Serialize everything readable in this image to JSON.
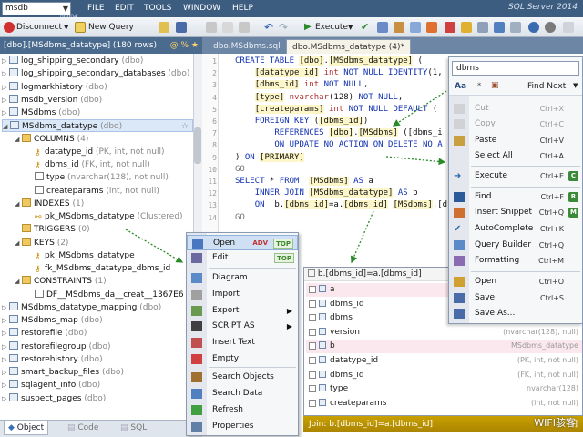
{
  "app": {
    "db_select": "msdb",
    "db_sub": "dbo04",
    "brand": "SQL Server 2014"
  },
  "menu": [
    "FILE",
    "EDIT",
    "TOOLS",
    "WINDOW",
    "HELP"
  ],
  "toolbar": {
    "disconnect": "Disconnect",
    "new_query": "New Query",
    "execute": "Execute"
  },
  "left_panel": {
    "title": "[dbo].[MSdbms_datatype] (180 rows)",
    "tabs": [
      "Object",
      "Code",
      "SQL"
    ]
  },
  "tree": [
    {
      "label": "log_shipping_secondary",
      "note": "(dbo)"
    },
    {
      "label": "log_shipping_secondary_databases",
      "note": "(dbo)"
    },
    {
      "label": "logmarkhistory",
      "note": "(dbo)"
    },
    {
      "label": "msdb_version",
      "note": "(dbo)"
    },
    {
      "label": "MSdbms",
      "note": "(dbo)"
    },
    {
      "label": "MSdbms_datatype",
      "note": "(dbo)"
    },
    {
      "label": "COLUMNS",
      "note": "(4)"
    },
    {
      "label": "datatype_id",
      "note": "(PK, int, not null)"
    },
    {
      "label": "dbms_id",
      "note": "(FK, int, not null)"
    },
    {
      "label": "type",
      "note": "(nvarchar(128), not null)"
    },
    {
      "label": "createparams",
      "note": "(int, not null)"
    },
    {
      "label": "INDEXES",
      "note": "(1)"
    },
    {
      "label": "pk_MSdbms_datatype",
      "note": "(Clustered)"
    },
    {
      "label": "TRIGGERS",
      "note": "(0)"
    },
    {
      "label": "KEYS",
      "note": "(2)"
    },
    {
      "label": "pk_MSdbms_datatype",
      "note": ""
    },
    {
      "label": "fk_MSdbms_datatype_dbms_id",
      "note": ""
    },
    {
      "label": "CONSTRAINTS",
      "note": "(1)"
    },
    {
      "label": "DF__MSdbms_da__creat__1367E6",
      "note": ""
    },
    {
      "label": "MSdbms_datatype_mapping",
      "note": "(dbo)"
    },
    {
      "label": "MSdbms_map",
      "note": "(dbo)"
    },
    {
      "label": "restorefile",
      "note": "(dbo)"
    },
    {
      "label": "restorefilegroup",
      "note": "(dbo)"
    },
    {
      "label": "restorehistory",
      "note": "(dbo)"
    },
    {
      "label": "smart_backup_files",
      "note": "(dbo)"
    },
    {
      "label": "sqlagent_info",
      "note": "(dbo)"
    },
    {
      "label": "suspect_pages",
      "note": "(dbo)"
    }
  ],
  "editor_tabs": [
    "dbo.MSdbms.sql",
    "dbo.MSdbms_datatype (4)*"
  ],
  "code": [
    "CREATE TABLE [dbo].[MSdbms_datatype] (",
    "    [datatype_id] int NOT NULL IDENTITY(1,",
    "    [dbms_id] int NOT NULL,",
    "    [type] nvarchar(128) NOT NULL,",
    "    [createparams] int NOT NULL DEFAULT (",
    "    FOREIGN KEY ([dbms_id])",
    "        REFERENCES [dbo].[MSdbms] ([dbms_i",
    "        ON UPDATE NO ACTION ON DELETE NO A",
    ") ON [PRIMARY]",
    "GO",
    "SELECT * FROM  [MSdbms] AS a",
    "    INNER JOIN [MSdbms_datatype] AS b",
    "    ON  b.[dbms_id]=a.[dbms_id] [MSdbms].[d",
    "GO"
  ],
  "autocomplete": {
    "header": "b.[dbms_id]=a.[dbms_id]",
    "rows": [
      {
        "label": "a",
        "note": "",
        "pink": true
      },
      {
        "label": "dbms_id",
        "note": "",
        "pink": false
      },
      {
        "label": "dbms",
        "note": "",
        "pink": false
      },
      {
        "label": "version",
        "note": "(nvarchar(128), null)",
        "pink": false
      },
      {
        "label": "b",
        "note": "MSdbms_datatype",
        "pink": true
      },
      {
        "label": "datatype_id",
        "note": "(PK, int, not null)",
        "pink": false
      },
      {
        "label": "dbms_id",
        "note": "(FK, int, not null)",
        "pink": false
      },
      {
        "label": "type",
        "note": "nvarchar(128)",
        "pink": false
      },
      {
        "label": "createparams",
        "note": "(int, not null)",
        "pink": false
      }
    ],
    "footer": "Join: b.[dbms_id]=a.[dbms_id]",
    "footer_q": "[?]"
  },
  "context_left": [
    {
      "label": "Open",
      "tag": "ADV",
      "tag2": "TOP"
    },
    {
      "label": "Edit",
      "tag": "",
      "tag2": "TOP"
    },
    {
      "label": "Diagram"
    },
    {
      "label": "Import"
    },
    {
      "label": "Export",
      "sub": true
    },
    {
      "label": "SCRIPT AS",
      "sub": true
    },
    {
      "label": "Insert Text"
    },
    {
      "label": "Empty"
    },
    {
      "label": "Search Objects"
    },
    {
      "label": "Search Data"
    },
    {
      "label": "Refresh"
    },
    {
      "label": "Properties"
    }
  ],
  "context_right": {
    "search": "dbms",
    "find_next": "Find Next",
    "items": [
      {
        "label": "Cut",
        "sc": "Ctrl+X",
        "dis": true,
        "key": ""
      },
      {
        "label": "Copy",
        "sc": "Ctrl+C",
        "dis": true,
        "key": ""
      },
      {
        "label": "Paste",
        "sc": "Ctrl+V",
        "dis": false,
        "key": ""
      },
      {
        "label": "Select All",
        "sc": "Ctrl+A",
        "dis": false,
        "key": ""
      },
      {
        "label": "Execute",
        "sc": "Ctrl+E",
        "dis": false,
        "key": "C"
      },
      {
        "label": "Find",
        "sc": "Ctrl+F",
        "dis": false,
        "key": "R"
      },
      {
        "label": "Insert Snippet",
        "sc": "Ctrl+Q",
        "dis": false,
        "key": "M"
      },
      {
        "label": "AutoComplete",
        "sc": "Ctrl+K",
        "dis": false,
        "key": ""
      },
      {
        "label": "Query Builder",
        "sc": "Ctrl+Q",
        "dis": false,
        "key": ""
      },
      {
        "label": "Formatting",
        "sc": "Ctrl+M",
        "dis": false,
        "key": ""
      },
      {
        "label": "Open",
        "sc": "Ctrl+O",
        "dis": false,
        "key": ""
      },
      {
        "label": "Save",
        "sc": "Ctrl+S",
        "dis": false,
        "key": ""
      },
      {
        "label": "Save As...",
        "sc": "",
        "dis": false,
        "key": ""
      }
    ]
  },
  "watermark": "WIFI骇客",
  "colors": {
    "accent": "#3c5c80",
    "autocomplete_footer": "#b89000"
  }
}
